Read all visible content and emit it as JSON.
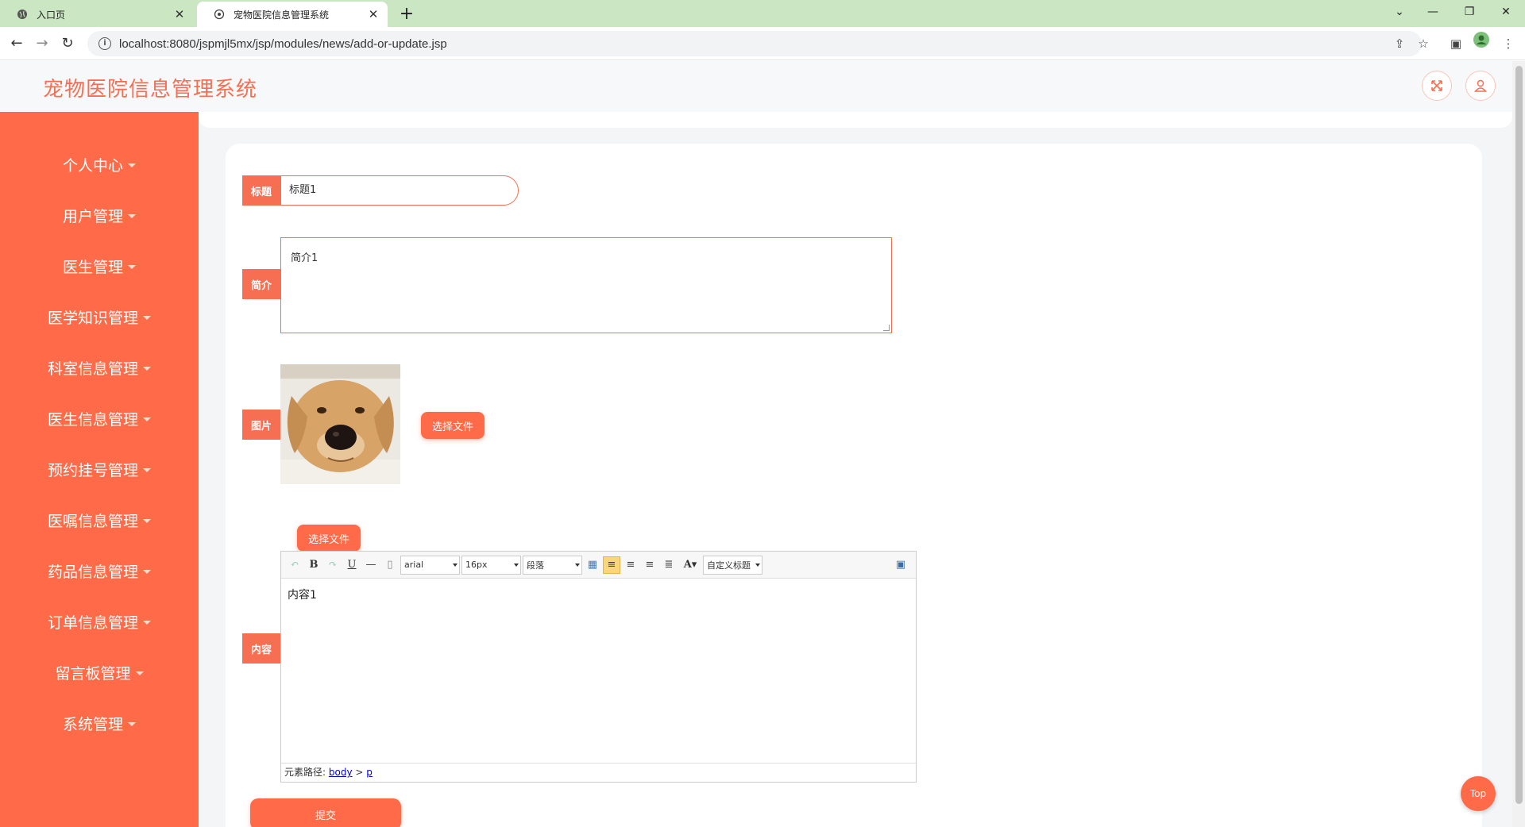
{
  "browser": {
    "tabs": [
      {
        "title": "入口页",
        "active": false
      },
      {
        "title": "宠物医院信息管理系统",
        "active": true
      }
    ],
    "url": "localhost:8080/jspmjl5mx/jsp/modules/news/add-or-update.jsp"
  },
  "header": {
    "title": "宠物医院信息管理系统"
  },
  "sidebar": {
    "items": [
      {
        "label": "个人中心"
      },
      {
        "label": "用户管理"
      },
      {
        "label": "医生管理"
      },
      {
        "label": "医学知识管理"
      },
      {
        "label": "科室信息管理"
      },
      {
        "label": "医生信息管理"
      },
      {
        "label": "预约挂号管理"
      },
      {
        "label": "医嘱信息管理"
      },
      {
        "label": "药品信息管理"
      },
      {
        "label": "订单信息管理"
      },
      {
        "label": "留言板管理"
      },
      {
        "label": "系统管理"
      }
    ]
  },
  "form": {
    "title_label": "标题",
    "title_value": "标题1",
    "summary_label": "简介",
    "summary_value": "简介1",
    "image_label": "图片",
    "choose_file_label": "选择文件",
    "content_label": "内容",
    "content_choose_file_label": "选择文件",
    "submit_label": "提交"
  },
  "editor": {
    "font_family": "arial",
    "font_size": "16px",
    "paragraph": "段落",
    "custom_title": "自定义标题",
    "body_text": "内容1",
    "path_prefix": "元素路径:",
    "path_body": "body",
    "path_sep": ">",
    "path_p": "p"
  },
  "top_button": "Top",
  "colors": {
    "accent": "#ff6a48",
    "title": "#f76f52",
    "tabbar": "#cbe6c2"
  }
}
